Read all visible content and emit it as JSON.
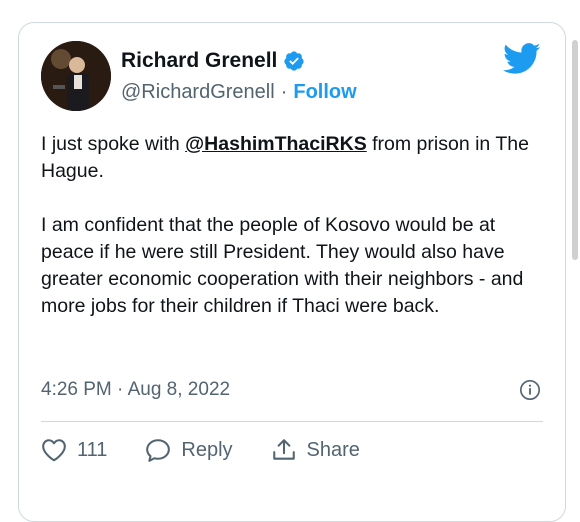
{
  "tweet": {
    "author_name": "Richard Grenell",
    "handle": "@RichardGrenell",
    "separator": "·",
    "follow_label": "Follow",
    "text_part1": "I just spoke with ",
    "mention": "@HashimThaciRKS",
    "text_part2": " from prison in The Hague.",
    "text_paragraph2": "I am confident that the people of Kosovo would be at peace if he were still President. They would also have greater economic cooperation with their neighbors - and more jobs for their children if Thaci were back.",
    "timestamp": "4:26 PM · Aug 8, 2022",
    "like_count": "111",
    "reply_label": "Reply",
    "share_label": "Share"
  },
  "icons": {
    "verified": "verified-badge-icon",
    "brand": "twitter-bird-icon",
    "info": "info-icon",
    "like": "heart-icon",
    "reply": "speech-bubble-icon",
    "share": "share-upload-icon"
  },
  "colors": {
    "accent": "#1d9bf0",
    "text": "#0f1419",
    "secondary": "#536471",
    "border": "#cfd9de"
  }
}
